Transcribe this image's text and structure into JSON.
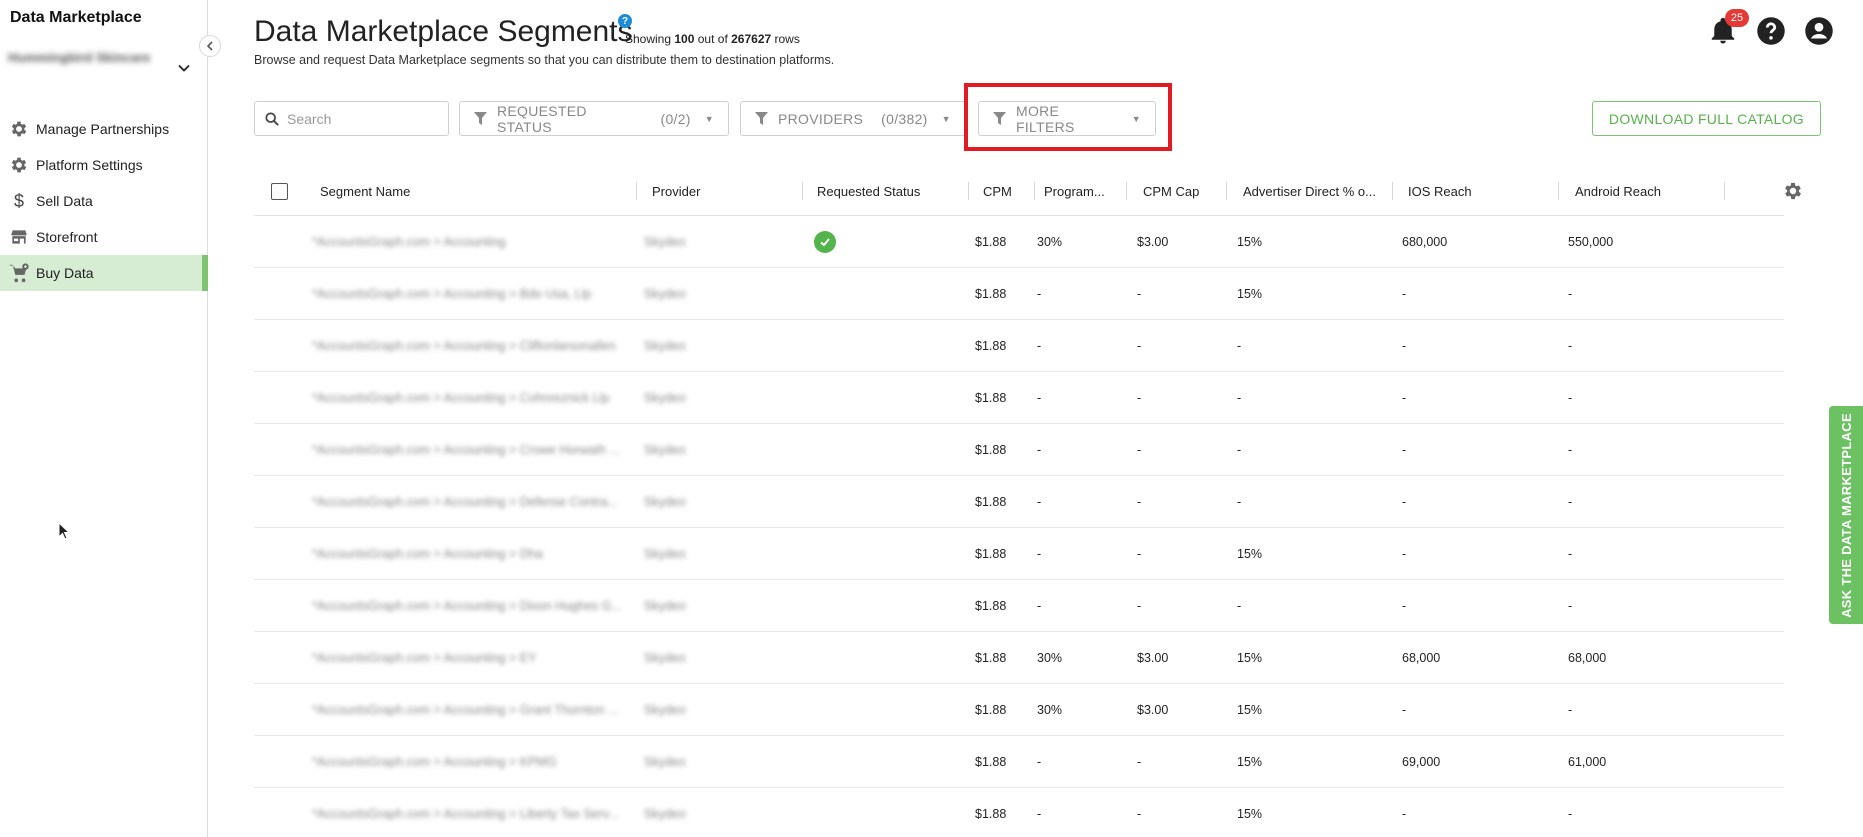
{
  "sidebar": {
    "app_title": "Data Marketplace",
    "account_name": "Hummingbird Skincare",
    "items": [
      {
        "label": "Manage Partnerships",
        "icon": "gear-icon"
      },
      {
        "label": "Platform Settings",
        "icon": "gear-icon"
      },
      {
        "label": "Sell Data",
        "icon": "dollar-icon"
      },
      {
        "label": "Storefront",
        "icon": "store-icon"
      },
      {
        "label": "Buy Data",
        "icon": "cart-icon",
        "active": true
      }
    ]
  },
  "header": {
    "title": "Data Marketplace Segments",
    "help": "?",
    "showing_prefix": "Showing",
    "showing_count": "100",
    "showing_mid": "out of",
    "total_rows": "267627",
    "showing_suffix": "rows",
    "subtitle": "Browse and request Data Marketplace segments so that you can distribute them to destination platforms.",
    "notification_count": "25"
  },
  "filters": {
    "search_placeholder": "Search",
    "requested_status_label": "REQUESTED STATUS",
    "requested_status_count": "(0/2)",
    "providers_label": "PROVIDERS",
    "providers_count": "(0/382)",
    "more_filters_label": "MORE FILTERS",
    "download_label": "DOWNLOAD FULL CATALOG"
  },
  "table": {
    "headers": {
      "segment_name": "Segment Name",
      "provider": "Provider",
      "requested_status": "Requested Status",
      "cpm": "CPM",
      "programmatic": "Program...",
      "cpm_cap": "CPM Cap",
      "advertiser_direct": "Advertiser Direct % o...",
      "ios_reach": "IOS Reach",
      "android_reach": "Android Reach"
    },
    "rows": [
      {
        "segment": "*AccountsGraph.com > Accounting",
        "provider": "Skydeo",
        "requested": true,
        "cpm": "$1.88",
        "prog": "30%",
        "cap": "$3.00",
        "adv": "15%",
        "ios": "680,000",
        "android": "550,000"
      },
      {
        "segment": "*AccountsGraph.com > Accounting > Bdo Usa, Llp",
        "provider": "Skydeo",
        "requested": false,
        "cpm": "$1.88",
        "prog": "-",
        "cap": "-",
        "adv": "15%",
        "ios": "-",
        "android": "-"
      },
      {
        "segment": "*AccountsGraph.com > Accounting > Cliftonlarsonallen",
        "provider": "Skydeo",
        "requested": false,
        "cpm": "$1.88",
        "prog": "-",
        "cap": "-",
        "adv": "-",
        "ios": "-",
        "android": "-"
      },
      {
        "segment": "*AccountsGraph.com > Accounting > Cohnreznick Llp",
        "provider": "Skydeo",
        "requested": false,
        "cpm": "$1.88",
        "prog": "-",
        "cap": "-",
        "adv": "-",
        "ios": "-",
        "android": "-"
      },
      {
        "segment": "*AccountsGraph.com > Accounting > Crowe Horwath ...",
        "provider": "Skydeo",
        "requested": false,
        "cpm": "$1.88",
        "prog": "-",
        "cap": "-",
        "adv": "-",
        "ios": "-",
        "android": "-"
      },
      {
        "segment": "*AccountsGraph.com > Accounting > Defense Contra...",
        "provider": "Skydeo",
        "requested": false,
        "cpm": "$1.88",
        "prog": "-",
        "cap": "-",
        "adv": "-",
        "ios": "-",
        "android": "-"
      },
      {
        "segment": "*AccountsGraph.com > Accounting > Dha",
        "provider": "Skydeo",
        "requested": false,
        "cpm": "$1.88",
        "prog": "-",
        "cap": "-",
        "adv": "15%",
        "ios": "-",
        "android": "-"
      },
      {
        "segment": "*AccountsGraph.com > Accounting > Dixon Hughes G...",
        "provider": "Skydeo",
        "requested": false,
        "cpm": "$1.88",
        "prog": "-",
        "cap": "-",
        "adv": "-",
        "ios": "-",
        "android": "-"
      },
      {
        "segment": "*AccountsGraph.com > Accounting > EY",
        "provider": "Skydeo",
        "requested": false,
        "cpm": "$1.88",
        "prog": "30%",
        "cap": "$3.00",
        "adv": "15%",
        "ios": "68,000",
        "android": "68,000"
      },
      {
        "segment": "*AccountsGraph.com > Accounting > Grant Thornton ...",
        "provider": "Skydeo",
        "requested": false,
        "cpm": "$1.88",
        "prog": "30%",
        "cap": "$3.00",
        "adv": "15%",
        "ios": "-",
        "android": "-"
      },
      {
        "segment": "*AccountsGraph.com > Accounting > KPMG",
        "provider": "Skydeo",
        "requested": false,
        "cpm": "$1.88",
        "prog": "-",
        "cap": "-",
        "adv": "15%",
        "ios": "69,000",
        "android": "61,000"
      },
      {
        "segment": "*AccountsGraph.com > Accounting > Liberty Tax Serv...",
        "provider": "Skydeo",
        "requested": false,
        "cpm": "$1.88",
        "prog": "-",
        "cap": "-",
        "adv": "15%",
        "ios": "-",
        "android": "-"
      }
    ]
  },
  "side_tab": {
    "label": "ASK THE DATA MARKETPLACE"
  },
  "colors": {
    "accent_green": "#7cc46f",
    "highlight_red": "#e01b24",
    "badge_red": "#e53935",
    "help_blue": "#1e8bd6"
  }
}
